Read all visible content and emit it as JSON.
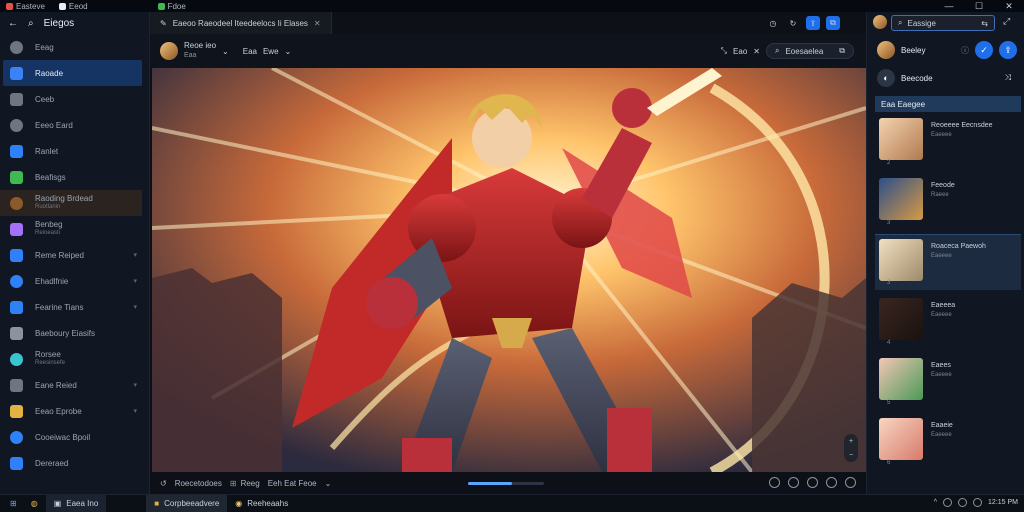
{
  "titlebar": {
    "tabs": [
      {
        "label": "Easteve",
        "color": "#e5534b"
      },
      {
        "label": "Eeod",
        "color": "#e6edf3"
      }
    ],
    "controls": [
      "—",
      "☐",
      "✕"
    ]
  },
  "sidebar": {
    "top_label": "Eiegos",
    "items": [
      {
        "label": "Eeag",
        "icon": "globe-icon"
      },
      {
        "label": "Raoade",
        "icon": "home-icon",
        "active": true
      },
      {
        "label": "Ceeb",
        "icon": "folder-icon"
      },
      {
        "label": "Eeeo Eard",
        "icon": "chat-icon"
      },
      {
        "label": "Ranlet",
        "icon": "edge-icon"
      },
      {
        "label": "Beafisgs",
        "icon": "leaf-icon"
      },
      {
        "label": "Raoding Brdead",
        "sub": "Ruotlanin",
        "icon": "image-icon",
        "hl": true
      },
      {
        "label": "Benbeg",
        "sub": "Reioeasti",
        "icon": "puzzle-icon"
      },
      {
        "label": "Reme Reiped",
        "icon": "chart-icon",
        "arrow": true
      },
      {
        "label": "Ehadlfnie",
        "icon": "window-icon",
        "arrow": true
      },
      {
        "label": "Fearine Tians",
        "icon": "app-icon",
        "arrow": true
      },
      {
        "label": "Baeboury Eiasifs",
        "icon": "user-icon"
      },
      {
        "label": "Rorsee",
        "sub": "Reesinsefe",
        "icon": "calendar-icon"
      },
      {
        "label": "Eane Reied",
        "icon": "settings-icon",
        "arrow": true
      },
      {
        "label": "Eeao Eprobe",
        "icon": "chrome-icon",
        "arrow": true
      },
      {
        "label": "Cooeiwac Bpoil",
        "icon": "link-icon"
      },
      {
        "label": "Dereraed",
        "icon": "clock-icon"
      }
    ]
  },
  "center": {
    "tab_label": "Eaeoo Raeodeel Iteedeelocs Ii Elases",
    "toolbar": {
      "user_label": "Reoe ieo",
      "user_sub": "Eaa",
      "zoom_label": "Eaa",
      "mode_label": "Ewe",
      "size_label": "Eao",
      "search_value": "Eoesaelea"
    },
    "status": {
      "file_name": "Roecetodoes",
      "mode": "Reeg",
      "dims": "Eeh Eat Feoe",
      "progress": 0.58
    }
  },
  "rpanel": {
    "search_value": "Eassige",
    "user_label": "Beeley",
    "list_label": "Beecode",
    "section_header": "Eaa Eaegee",
    "cards": [
      {
        "title": "Reoeeee Eecnsdee",
        "sub": "Eaeeee",
        "num": "2"
      },
      {
        "title": "Feeode",
        "sub": "Raeee",
        "num": "3"
      },
      {
        "title": "Roaceca Paewoh",
        "sub": "Eaeeee",
        "num": "3",
        "selected": true
      },
      {
        "title": "Eaeeea",
        "sub": "Eaeeee",
        "num": "4"
      },
      {
        "title": "Eaees",
        "sub": "Eaeeee",
        "num": "5"
      },
      {
        "title": "Eaaeie",
        "sub": "Eaeeee",
        "num": "6"
      }
    ]
  },
  "taskbar": {
    "items": [
      {
        "label": "Eaea Ino"
      },
      {
        "label": "Corpbeeadvere"
      },
      {
        "label": "Reeheaahs"
      }
    ],
    "tray_time": "12:15 PM"
  }
}
